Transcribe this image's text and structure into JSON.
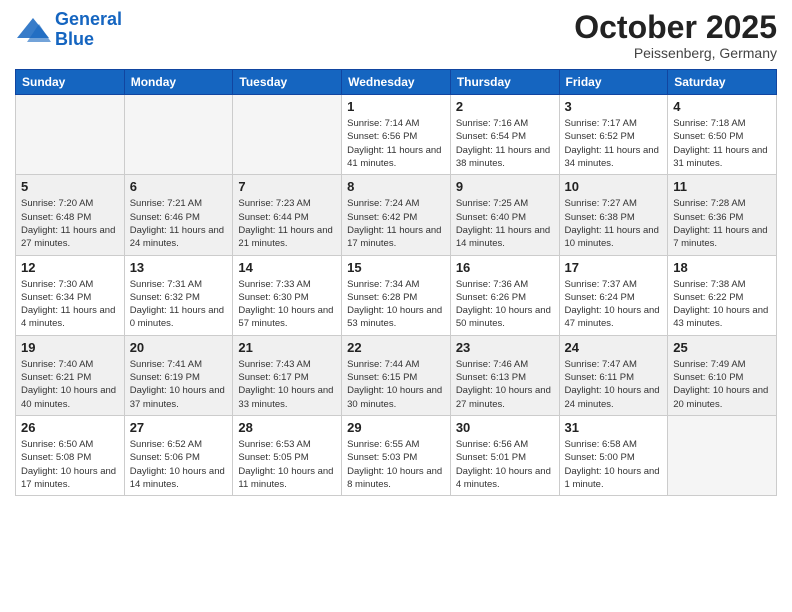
{
  "logo": {
    "line1": "General",
    "line2": "Blue"
  },
  "title": "October 2025",
  "location": "Peissenberg, Germany",
  "weekdays": [
    "Sunday",
    "Monday",
    "Tuesday",
    "Wednesday",
    "Thursday",
    "Friday",
    "Saturday"
  ],
  "weeks": [
    [
      {
        "day": "",
        "info": ""
      },
      {
        "day": "",
        "info": ""
      },
      {
        "day": "",
        "info": ""
      },
      {
        "day": "1",
        "info": "Sunrise: 7:14 AM\nSunset: 6:56 PM\nDaylight: 11 hours and 41 minutes."
      },
      {
        "day": "2",
        "info": "Sunrise: 7:16 AM\nSunset: 6:54 PM\nDaylight: 11 hours and 38 minutes."
      },
      {
        "day": "3",
        "info": "Sunrise: 7:17 AM\nSunset: 6:52 PM\nDaylight: 11 hours and 34 minutes."
      },
      {
        "day": "4",
        "info": "Sunrise: 7:18 AM\nSunset: 6:50 PM\nDaylight: 11 hours and 31 minutes."
      }
    ],
    [
      {
        "day": "5",
        "info": "Sunrise: 7:20 AM\nSunset: 6:48 PM\nDaylight: 11 hours and 27 minutes."
      },
      {
        "day": "6",
        "info": "Sunrise: 7:21 AM\nSunset: 6:46 PM\nDaylight: 11 hours and 24 minutes."
      },
      {
        "day": "7",
        "info": "Sunrise: 7:23 AM\nSunset: 6:44 PM\nDaylight: 11 hours and 21 minutes."
      },
      {
        "day": "8",
        "info": "Sunrise: 7:24 AM\nSunset: 6:42 PM\nDaylight: 11 hours and 17 minutes."
      },
      {
        "day": "9",
        "info": "Sunrise: 7:25 AM\nSunset: 6:40 PM\nDaylight: 11 hours and 14 minutes."
      },
      {
        "day": "10",
        "info": "Sunrise: 7:27 AM\nSunset: 6:38 PM\nDaylight: 11 hours and 10 minutes."
      },
      {
        "day": "11",
        "info": "Sunrise: 7:28 AM\nSunset: 6:36 PM\nDaylight: 11 hours and 7 minutes."
      }
    ],
    [
      {
        "day": "12",
        "info": "Sunrise: 7:30 AM\nSunset: 6:34 PM\nDaylight: 11 hours and 4 minutes."
      },
      {
        "day": "13",
        "info": "Sunrise: 7:31 AM\nSunset: 6:32 PM\nDaylight: 11 hours and 0 minutes."
      },
      {
        "day": "14",
        "info": "Sunrise: 7:33 AM\nSunset: 6:30 PM\nDaylight: 10 hours and 57 minutes."
      },
      {
        "day": "15",
        "info": "Sunrise: 7:34 AM\nSunset: 6:28 PM\nDaylight: 10 hours and 53 minutes."
      },
      {
        "day": "16",
        "info": "Sunrise: 7:36 AM\nSunset: 6:26 PM\nDaylight: 10 hours and 50 minutes."
      },
      {
        "day": "17",
        "info": "Sunrise: 7:37 AM\nSunset: 6:24 PM\nDaylight: 10 hours and 47 minutes."
      },
      {
        "day": "18",
        "info": "Sunrise: 7:38 AM\nSunset: 6:22 PM\nDaylight: 10 hours and 43 minutes."
      }
    ],
    [
      {
        "day": "19",
        "info": "Sunrise: 7:40 AM\nSunset: 6:21 PM\nDaylight: 10 hours and 40 minutes."
      },
      {
        "day": "20",
        "info": "Sunrise: 7:41 AM\nSunset: 6:19 PM\nDaylight: 10 hours and 37 minutes."
      },
      {
        "day": "21",
        "info": "Sunrise: 7:43 AM\nSunset: 6:17 PM\nDaylight: 10 hours and 33 minutes."
      },
      {
        "day": "22",
        "info": "Sunrise: 7:44 AM\nSunset: 6:15 PM\nDaylight: 10 hours and 30 minutes."
      },
      {
        "day": "23",
        "info": "Sunrise: 7:46 AM\nSunset: 6:13 PM\nDaylight: 10 hours and 27 minutes."
      },
      {
        "day": "24",
        "info": "Sunrise: 7:47 AM\nSunset: 6:11 PM\nDaylight: 10 hours and 24 minutes."
      },
      {
        "day": "25",
        "info": "Sunrise: 7:49 AM\nSunset: 6:10 PM\nDaylight: 10 hours and 20 minutes."
      }
    ],
    [
      {
        "day": "26",
        "info": "Sunrise: 6:50 AM\nSunset: 5:08 PM\nDaylight: 10 hours and 17 minutes."
      },
      {
        "day": "27",
        "info": "Sunrise: 6:52 AM\nSunset: 5:06 PM\nDaylight: 10 hours and 14 minutes."
      },
      {
        "day": "28",
        "info": "Sunrise: 6:53 AM\nSunset: 5:05 PM\nDaylight: 10 hours and 11 minutes."
      },
      {
        "day": "29",
        "info": "Sunrise: 6:55 AM\nSunset: 5:03 PM\nDaylight: 10 hours and 8 minutes."
      },
      {
        "day": "30",
        "info": "Sunrise: 6:56 AM\nSunset: 5:01 PM\nDaylight: 10 hours and 4 minutes."
      },
      {
        "day": "31",
        "info": "Sunrise: 6:58 AM\nSunset: 5:00 PM\nDaylight: 10 hours and 1 minute."
      },
      {
        "day": "",
        "info": ""
      }
    ]
  ]
}
